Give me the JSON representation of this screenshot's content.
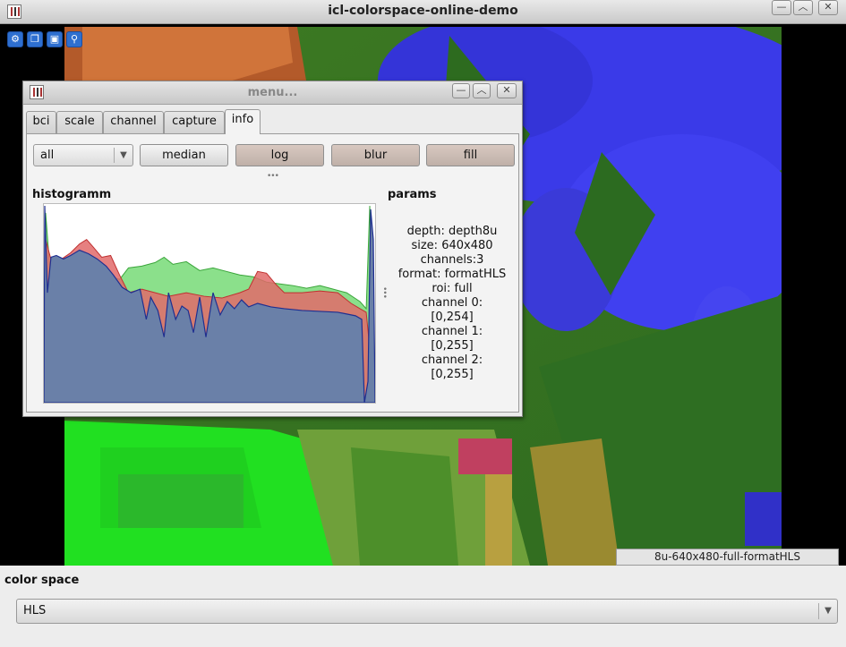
{
  "window": {
    "title": "icl-colorspace-online-demo",
    "controls": [
      "minimize",
      "maximize",
      "close"
    ]
  },
  "toolbar": {
    "icons": [
      "wrench-icon",
      "copy-icon",
      "window-icon",
      "zoom-icon"
    ]
  },
  "image_info": "8u-640x480-full-formatHLS",
  "menu": {
    "title": "menu...",
    "tabs": [
      "bci",
      "scale",
      "channel",
      "capture",
      "info"
    ],
    "active_tab": "info",
    "channel_select": "all",
    "buttons": [
      {
        "label": "median",
        "toggled": false
      },
      {
        "label": "log",
        "toggled": true
      },
      {
        "label": "blur",
        "toggled": true
      },
      {
        "label": "fill",
        "toggled": true
      }
    ],
    "histogram_label": "histogramm",
    "params_label": "params",
    "params": [
      "depth:   depth8u",
      "size:    640x480",
      "channels:3",
      "format:  formatHLS",
      "roi:   full",
      "channel 0:",
      "[0,254]",
      "channel 1:",
      "[0,255]",
      "channel 2:",
      "[0,255]"
    ]
  },
  "color_space": {
    "label": "color space",
    "value": "HLS"
  },
  "colors": {
    "hist_red": "#e05050",
    "hist_green": "#7de47d",
    "hist_blue": "#2b3ea8",
    "hist_fill_blue": "#6a80a8",
    "toggled_button": "#c9b9b1"
  }
}
